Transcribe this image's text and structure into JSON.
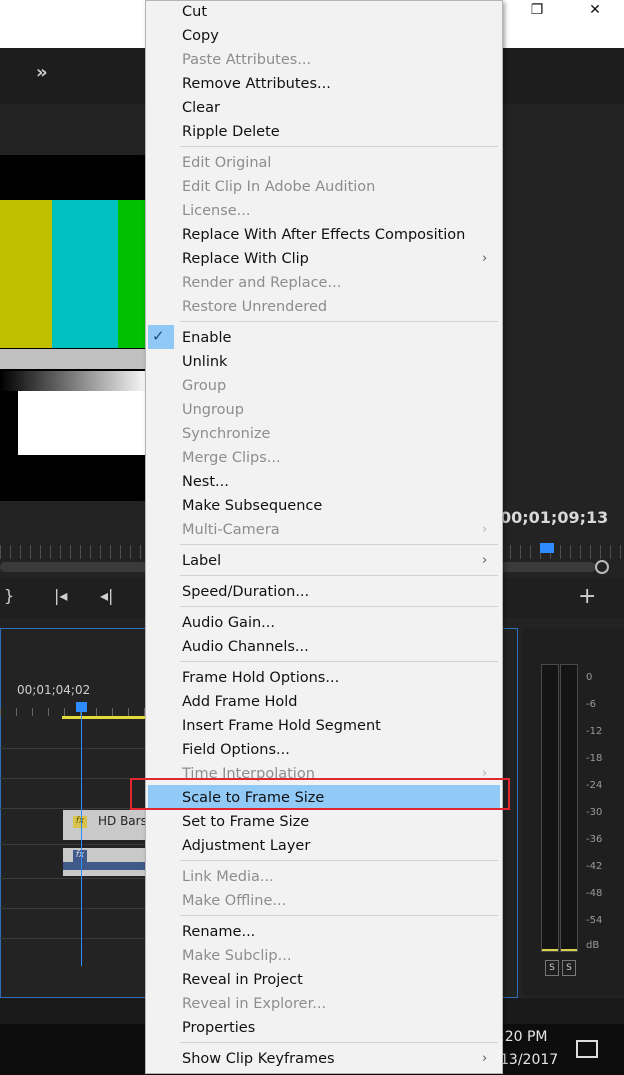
{
  "window": {
    "restore_glyph": "❐",
    "close_glyph": "✕"
  },
  "program": {
    "timecode": "00;01;09;13"
  },
  "timeline": {
    "timecode": "00;01;04;02",
    "clip_name": "HD Bars",
    "fx_label": "fx"
  },
  "meters": {
    "scale": [
      "0",
      "-6",
      "-12",
      "-18",
      "-24",
      "-30",
      "-36",
      "-42",
      "-48",
      "-54",
      "dB"
    ],
    "solo_left": "S",
    "solo_right": "S"
  },
  "taskbar": {
    "time": ":20 PM",
    "date": "13/2017"
  },
  "context_menu": {
    "items": [
      {
        "label": "Cut",
        "disabled": false
      },
      {
        "label": "Copy",
        "disabled": false
      },
      {
        "label": "Paste Attributes...",
        "disabled": true
      },
      {
        "label": "Remove Attributes...",
        "disabled": false
      },
      {
        "label": "Clear",
        "disabled": false
      },
      {
        "label": "Ripple Delete",
        "disabled": false
      },
      {
        "label": "Edit Original",
        "disabled": true
      },
      {
        "label": "Edit Clip In Adobe Audition",
        "disabled": true
      },
      {
        "label": "License...",
        "disabled": true
      },
      {
        "label": "Replace With After Effects Composition",
        "disabled": false
      },
      {
        "label": "Replace With Clip",
        "disabled": false,
        "submenu": true
      },
      {
        "label": "Render and Replace...",
        "disabled": true
      },
      {
        "label": "Restore Unrendered",
        "disabled": true
      },
      {
        "label": "Enable",
        "disabled": false,
        "checked": true
      },
      {
        "label": "Unlink",
        "disabled": false
      },
      {
        "label": "Group",
        "disabled": true
      },
      {
        "label": "Ungroup",
        "disabled": true
      },
      {
        "label": "Synchronize",
        "disabled": true
      },
      {
        "label": "Merge Clips...",
        "disabled": true
      },
      {
        "label": "Nest...",
        "disabled": false
      },
      {
        "label": "Make Subsequence",
        "disabled": false
      },
      {
        "label": "Multi-Camera",
        "disabled": true,
        "submenu": true
      },
      {
        "label": "Label",
        "disabled": false,
        "submenu": true
      },
      {
        "label": "Speed/Duration...",
        "disabled": false
      },
      {
        "label": "Audio Gain...",
        "disabled": false
      },
      {
        "label": "Audio Channels...",
        "disabled": false
      },
      {
        "label": "Frame Hold Options...",
        "disabled": false
      },
      {
        "label": "Add Frame Hold",
        "disabled": false
      },
      {
        "label": "Insert Frame Hold Segment",
        "disabled": false
      },
      {
        "label": "Field Options...",
        "disabled": false
      },
      {
        "label": "Time Interpolation",
        "disabled": true,
        "submenu": true
      },
      {
        "label": "Scale to Frame Size",
        "disabled": false,
        "highlighted": true
      },
      {
        "label": "Set to Frame Size",
        "disabled": false
      },
      {
        "label": "Adjustment Layer",
        "disabled": false
      },
      {
        "label": "Link Media...",
        "disabled": true
      },
      {
        "label": "Make Offline...",
        "disabled": true
      },
      {
        "label": "Rename...",
        "disabled": false
      },
      {
        "label": "Make Subclip...",
        "disabled": true
      },
      {
        "label": "Reveal in Project",
        "disabled": false
      },
      {
        "label": "Reveal in Explorer...",
        "disabled": true
      },
      {
        "label": "Properties",
        "disabled": false
      },
      {
        "label": "Show Clip Keyframes",
        "disabled": false,
        "submenu": true
      }
    ],
    "submenu_glyph": "›",
    "check_glyph": "✓"
  },
  "colors": {
    "highlight": "#91c9f7",
    "annotation_box": "#e0282e",
    "playhead": "#2e8cff"
  }
}
